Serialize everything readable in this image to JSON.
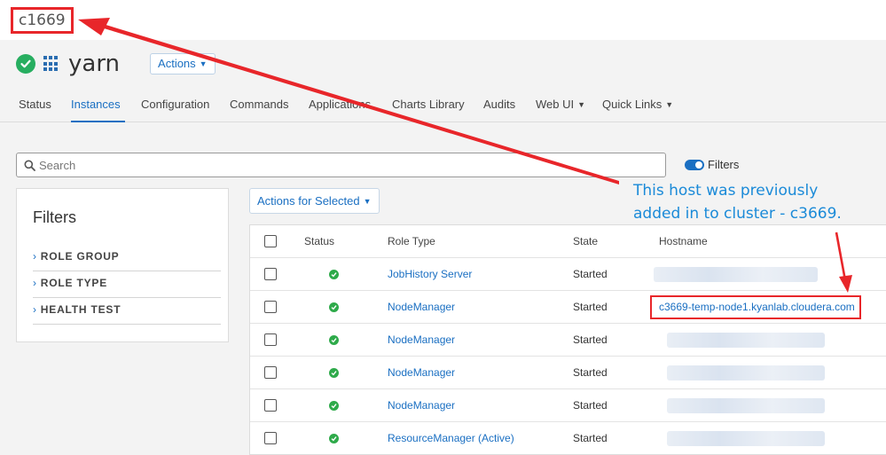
{
  "cluster": {
    "name": "c1669"
  },
  "service": {
    "name": "yarn",
    "actions_label": "Actions"
  },
  "tabs": [
    {
      "label": "Status"
    },
    {
      "label": "Instances"
    },
    {
      "label": "Configuration"
    },
    {
      "label": "Commands"
    },
    {
      "label": "Applications"
    },
    {
      "label": "Charts Library"
    },
    {
      "label": "Audits"
    },
    {
      "label": "Web UI"
    },
    {
      "label": "Quick Links"
    }
  ],
  "search": {
    "placeholder": "Search",
    "value": ""
  },
  "filters_toggle": {
    "label": "Filters"
  },
  "filters_panel": {
    "title": "Filters",
    "items": [
      {
        "label": "ROLE GROUP"
      },
      {
        "label": "ROLE TYPE"
      },
      {
        "label": "HEALTH TEST"
      }
    ]
  },
  "actions_for_selected": {
    "label": "Actions for Selected"
  },
  "table": {
    "columns": [
      "Status",
      "Role Type",
      "State",
      "Hostname"
    ],
    "rows": [
      {
        "role_type": "JobHistory Server",
        "state": "Started",
        "hostname": ""
      },
      {
        "role_type": "NodeManager",
        "state": "Started",
        "hostname": "c3669-temp-node1.kyanlab.cloudera.com"
      },
      {
        "role_type": "NodeManager",
        "state": "Started",
        "hostname": ""
      },
      {
        "role_type": "NodeManager",
        "state": "Started",
        "hostname": ""
      },
      {
        "role_type": "NodeManager",
        "state": "Started",
        "hostname": ""
      },
      {
        "role_type": "ResourceManager (Active)",
        "state": "Started",
        "hostname": ""
      }
    ]
  },
  "annotation": {
    "line1": "This host was previously",
    "line2": "added in to cluster - c3669."
  },
  "colors": {
    "accent": "#1a6fc2",
    "ok": "#27ae60",
    "highlight": "#e8262a",
    "annotation": "#1a8ad8"
  }
}
